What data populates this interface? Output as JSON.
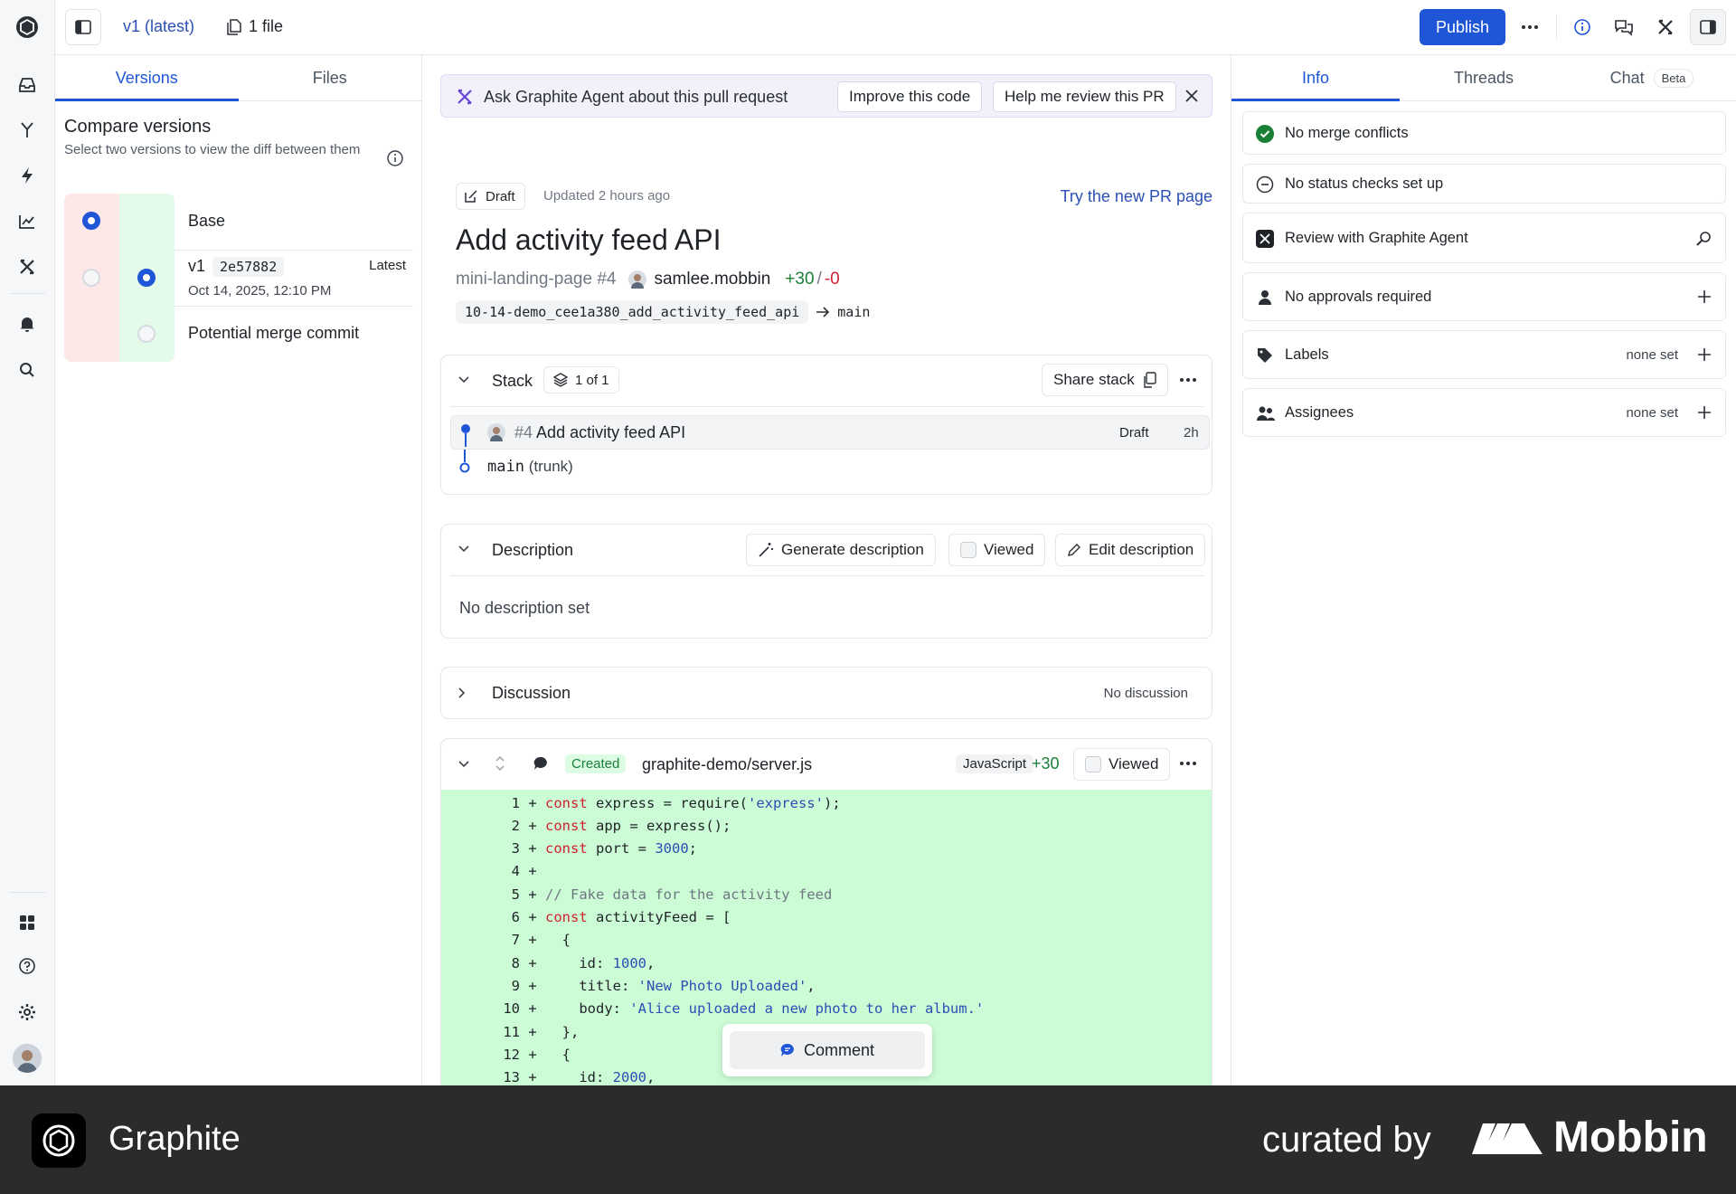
{
  "topbar": {
    "version_label": "v1 (latest)",
    "files_label": "1 file",
    "publish_label": "Publish"
  },
  "versions_panel": {
    "tabs": [
      "Versions",
      "Files"
    ],
    "compare_title": "Compare versions",
    "compare_subtitle": "Select two versions to view the diff between them",
    "rows": [
      {
        "label": "Base"
      },
      {
        "label": "v1",
        "hash": "2e57882",
        "date": "Oct 14, 2025, 12:10 PM",
        "tag": "Latest"
      },
      {
        "label": "Potential merge commit"
      }
    ]
  },
  "agent_bar": {
    "text": "Ask Graphite Agent about this pull request",
    "buttons": [
      "Improve this code",
      "Help me review this PR"
    ]
  },
  "pr": {
    "status": "Draft",
    "updated": "Updated 2 hours ago",
    "try_new": "Try the new PR page",
    "title": "Add activity feed API",
    "repo_ref": "mini-landing-page #4",
    "author": "samlee.mobbin",
    "additions": "+30",
    "separator": "/",
    "deletions": "-0",
    "branch": "10-14-demo_cee1a380_add_activity_feed_api",
    "base_branch": "main"
  },
  "stack": {
    "title": "Stack",
    "count": "1 of 1",
    "share_label": "Share stack",
    "item_ref": "#4",
    "item_title": "Add activity feed API",
    "item_status": "Draft",
    "item_age": "2h",
    "trunk_branch": "main",
    "trunk_suffix": "(trunk)"
  },
  "description": {
    "title": "Description",
    "generate_label": "Generate description",
    "viewed_label": "Viewed",
    "edit_label": "Edit description",
    "body": "No description set"
  },
  "discussion": {
    "title": "Discussion",
    "status": "No discussion"
  },
  "file": {
    "badge": "Created",
    "path": "graphite-demo/server.js",
    "language": "JavaScript",
    "additions": "+30",
    "viewed_label": "Viewed",
    "lines": [
      {
        "n": "1",
        "text": "const express = require('express');"
      },
      {
        "n": "2",
        "text": "const app = express();"
      },
      {
        "n": "3",
        "text": "const port = 3000;"
      },
      {
        "n": "4",
        "text": ""
      },
      {
        "n": "5",
        "text": "// Fake data for the activity feed"
      },
      {
        "n": "6",
        "text": "const activityFeed = ["
      },
      {
        "n": "7",
        "text": "  {"
      },
      {
        "n": "8",
        "text": "    id: 1000,"
      },
      {
        "n": "9",
        "text": "    title: 'New Photo Uploaded',"
      },
      {
        "n": "10",
        "text": "    body: 'Alice uploaded a new photo to her album.'"
      },
      {
        "n": "11",
        "text": "  },"
      },
      {
        "n": "12",
        "text": "  {"
      },
      {
        "n": "13",
        "text": "    id: 2000,"
      }
    ]
  },
  "comment_button": "Comment",
  "right_panel": {
    "tabs": [
      "Info",
      "Threads",
      "Chat"
    ],
    "beta_badge": "Beta",
    "merge_conflicts": "No merge conflicts",
    "status_checks": "No status checks set up",
    "review_agent": "Review with Graphite Agent",
    "approvals": "No approvals required",
    "labels_title": "Labels",
    "labels_value": "none set",
    "assignees_title": "Assignees",
    "assignees_value": "none set"
  },
  "footer": {
    "brand": "Graphite",
    "curated": "curated by",
    "mobbin": "Mobbin"
  },
  "colors": {
    "accent": "#1f56d8",
    "addition_bg": "#ccfcd6",
    "success": "#1a7f37"
  }
}
